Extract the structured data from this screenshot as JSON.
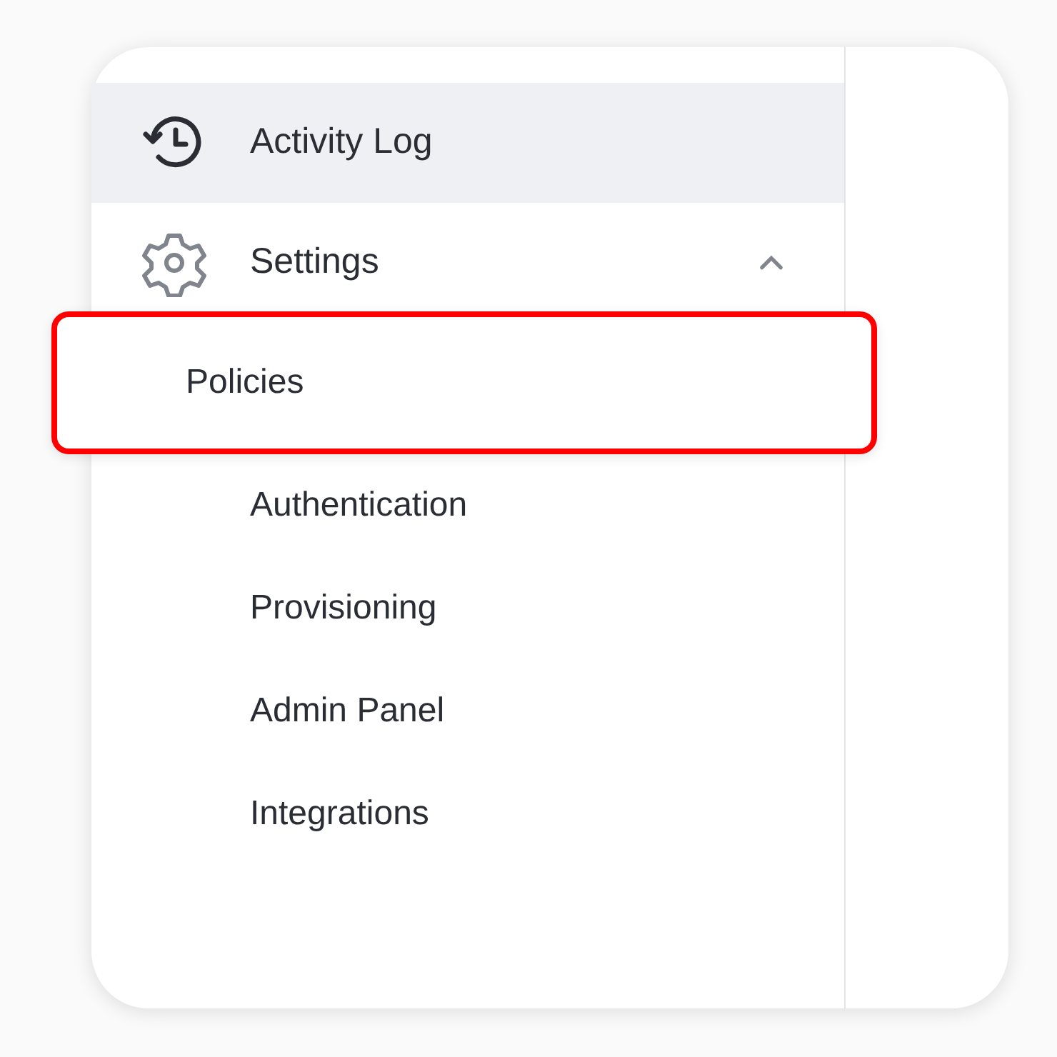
{
  "sidebar": {
    "items": [
      {
        "kind": "link",
        "label": "Activity Log",
        "selected": true
      },
      {
        "kind": "group",
        "label": "Settings",
        "selected": false,
        "expanded": true,
        "children": [
          {
            "label": "Policies",
            "highlighted": true
          },
          {
            "label": "Authentication",
            "highlighted": false
          },
          {
            "label": "Provisioning",
            "highlighted": false
          },
          {
            "label": "Admin Panel",
            "highlighted": false
          },
          {
            "label": "Integrations",
            "highlighted": false
          }
        ]
      }
    ]
  }
}
